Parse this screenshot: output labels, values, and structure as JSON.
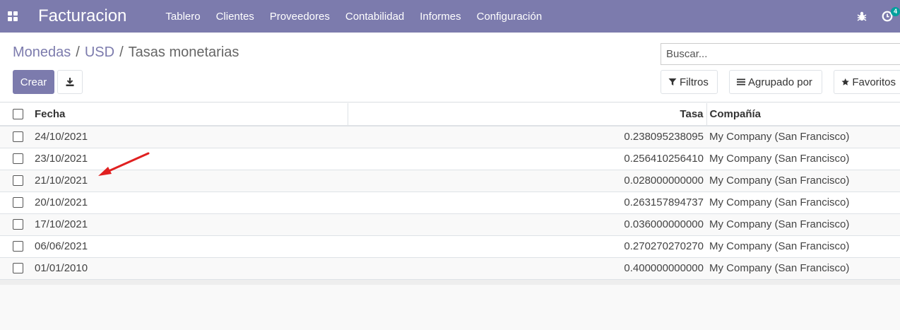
{
  "navbar": {
    "brand": "Facturacion",
    "menu": [
      "Tablero",
      "Clientes",
      "Proveedores",
      "Contabilidad",
      "Informes",
      "Configuración"
    ],
    "activity_count": "4",
    "color": "#7c7bad"
  },
  "breadcrumb": {
    "items": [
      "Monedas",
      "USD"
    ],
    "separator": "/",
    "current": "Tasas monetarias"
  },
  "buttons": {
    "create": "Crear",
    "download_icon": "download-icon"
  },
  "search": {
    "placeholder": "Buscar..."
  },
  "filters": {
    "filtros": "Filtros",
    "agrupado": "Agrupado por",
    "favoritos": "Favoritos"
  },
  "table": {
    "headers": {
      "fecha": "Fecha",
      "tasa": "Tasa",
      "company": "Compañía"
    },
    "rows": [
      {
        "fecha": "24/10/2021",
        "tasa": "0.238095238095",
        "company": "My Company (San Francisco)"
      },
      {
        "fecha": "23/10/2021",
        "tasa": "0.256410256410",
        "company": "My Company (San Francisco)"
      },
      {
        "fecha": "21/10/2021",
        "tasa": "0.028000000000",
        "company": "My Company (San Francisco)"
      },
      {
        "fecha": "20/10/2021",
        "tasa": "0.263157894737",
        "company": "My Company (San Francisco)"
      },
      {
        "fecha": "17/10/2021",
        "tasa": "0.036000000000",
        "company": "My Company (San Francisco)"
      },
      {
        "fecha": "06/06/2021",
        "tasa": "0.270270270270",
        "company": "My Company (San Francisco)"
      },
      {
        "fecha": "01/01/2010",
        "tasa": "0.400000000000",
        "company": "My Company (San Francisco)"
      }
    ]
  },
  "annotation": {
    "color": "#e02020"
  }
}
